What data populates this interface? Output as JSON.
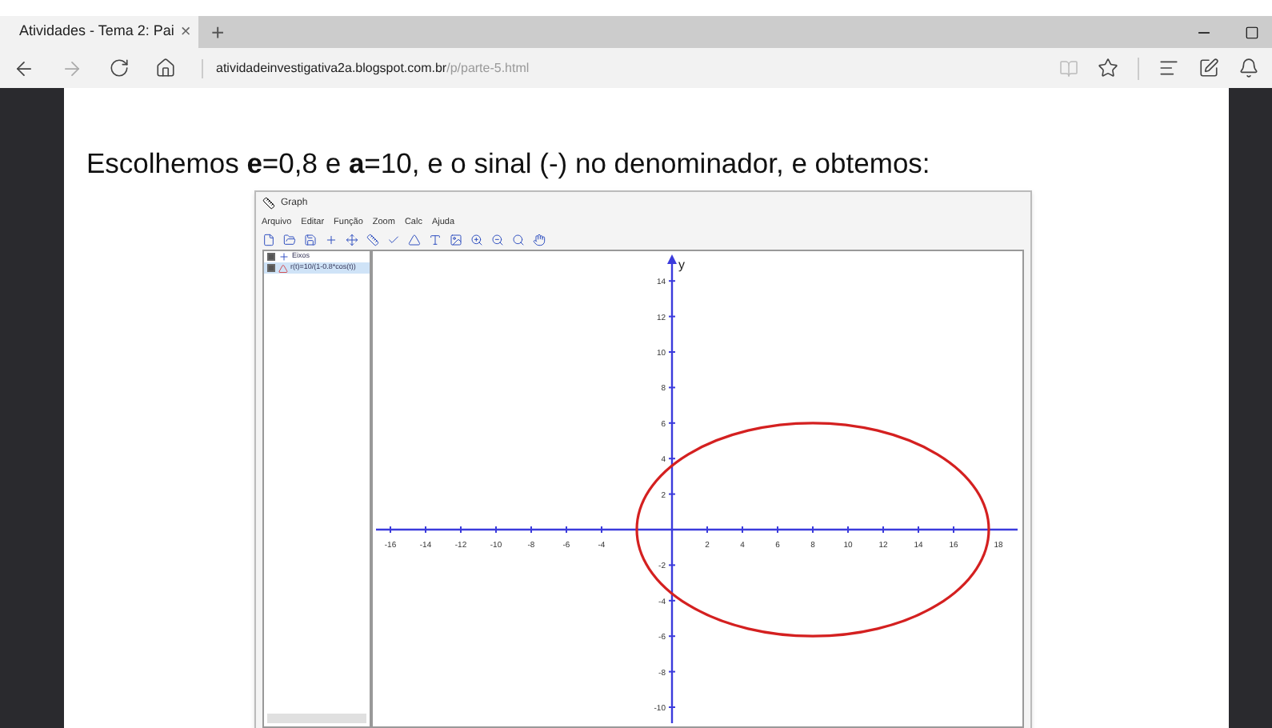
{
  "browser": {
    "tab": {
      "title": "Atividades - Tema 2: Pai",
      "close": "×",
      "selected": true
    },
    "new_tab": "+",
    "address": {
      "domain": "atividadeinvestigativa2a.blogspot.com.br",
      "path": "/p/parte-5.html"
    }
  },
  "page": {
    "heading": "Escolhemos **e**=0,8 e **a**=10, e o sinal (-) no denominador, e obtemos:"
  },
  "graph_app": {
    "title": "Graph",
    "menu": [
      "Arquivo",
      "Editar",
      "Função",
      "Zoom",
      "Calc",
      "Ajuda"
    ],
    "items": [
      {
        "label": "Eixos",
        "checked": true,
        "selected": false,
        "kind": "axes"
      },
      {
        "label": "r(t)=10/(1-0.8*cos(t))",
        "checked": true,
        "selected": true,
        "kind": "function"
      }
    ],
    "plot": {
      "y_axis_label": "y",
      "x_tick_labels": [
        "-16",
        "-14",
        "-12",
        "-10",
        "-8",
        "-6",
        "-4",
        "2",
        "4",
        "6",
        "8",
        "10",
        "12",
        "14",
        "16",
        "18"
      ],
      "y_tick_labels": [
        "14",
        "12",
        "10",
        "8",
        "6",
        "4",
        "2",
        "-2",
        "-4",
        "-6",
        "-8",
        "-10"
      ]
    }
  }
}
